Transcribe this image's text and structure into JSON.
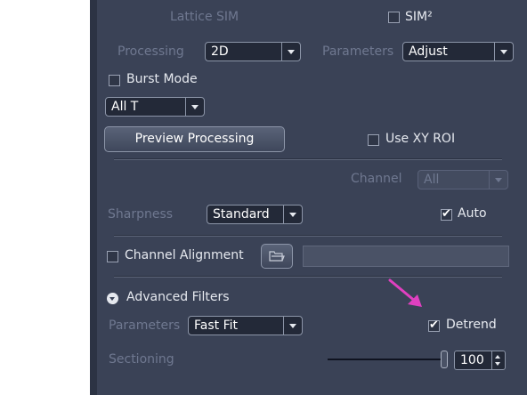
{
  "lattice_sim": {
    "label": "Lattice SIM",
    "sim2_label": "SIM²",
    "sim2_checked": false
  },
  "processing": {
    "label": "Processing",
    "value": "2D",
    "parameters_label": "Parameters",
    "parameters_value": "Adjust"
  },
  "burst_mode": {
    "label": "Burst Mode",
    "checked": false,
    "time_value": "All T"
  },
  "preview": {
    "button_label": "Preview Processing",
    "use_xy_roi_label": "Use XY ROI",
    "use_xy_roi_checked": false
  },
  "channel": {
    "label": "Channel",
    "value": "All"
  },
  "sharpness": {
    "label": "Sharpness",
    "value": "Standard",
    "auto_label": "Auto",
    "auto_checked": true
  },
  "alignment": {
    "label": "Channel Alignment",
    "checked": false,
    "path_value": ""
  },
  "advanced": {
    "label": "Advanced Filters",
    "parameters_label": "Parameters",
    "parameters_value": "Fast Fit",
    "detrend_label": "Detrend",
    "detrend_checked": true
  },
  "sectioning": {
    "label": "Sectioning",
    "value": "100",
    "slider_fraction": 1.0
  },
  "colors": {
    "panel": "#3a4256",
    "annotation_arrow": "#e040c0"
  }
}
